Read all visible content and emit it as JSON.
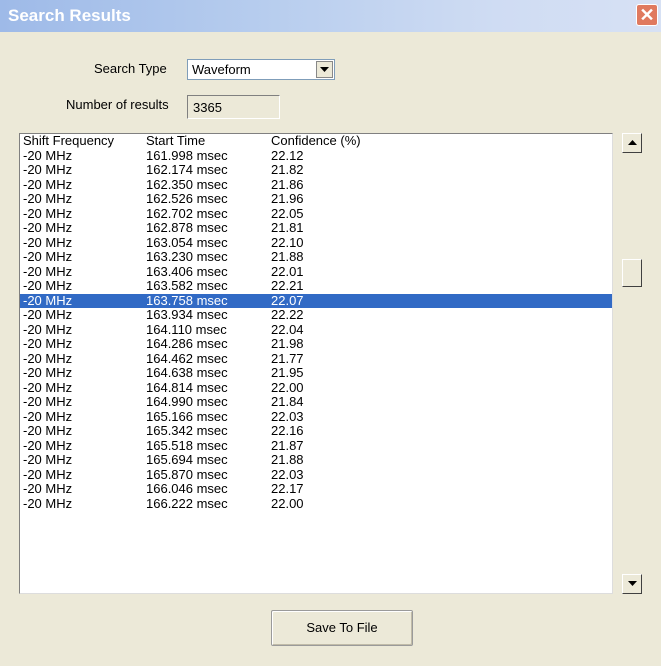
{
  "window": {
    "title": "Search Results",
    "close_glyph": "✕"
  },
  "search_type": {
    "label": "Search Type",
    "value": "Waveform"
  },
  "results_count": {
    "label": "Number of results",
    "value": "3365"
  },
  "table": {
    "headers": [
      "Shift Frequency",
      "Start Time",
      "Confidence (%)"
    ],
    "selected_index": 10,
    "rows": [
      [
        "-20 MHz",
        "161.998 msec",
        "22.12"
      ],
      [
        "-20 MHz",
        "162.174 msec",
        "21.82"
      ],
      [
        "-20 MHz",
        "162.350 msec",
        "21.86"
      ],
      [
        "-20 MHz",
        "162.526 msec",
        "21.96"
      ],
      [
        "-20 MHz",
        "162.702 msec",
        "22.05"
      ],
      [
        "-20 MHz",
        "162.878 msec",
        "21.81"
      ],
      [
        "-20 MHz",
        "163.054 msec",
        "22.10"
      ],
      [
        "-20 MHz",
        "163.230 msec",
        "21.88"
      ],
      [
        "-20 MHz",
        "163.406 msec",
        "22.01"
      ],
      [
        "-20 MHz",
        "163.582 msec",
        "22.21"
      ],
      [
        "-20 MHz",
        "163.758 msec",
        "22.07"
      ],
      [
        "-20 MHz",
        "163.934 msec",
        "22.22"
      ],
      [
        "-20 MHz",
        "164.110 msec",
        "22.04"
      ],
      [
        "-20 MHz",
        "164.286 msec",
        "21.98"
      ],
      [
        "-20 MHz",
        "164.462 msec",
        "21.77"
      ],
      [
        "-20 MHz",
        "164.638 msec",
        "21.95"
      ],
      [
        "-20 MHz",
        "164.814 msec",
        "22.00"
      ],
      [
        "-20 MHz",
        "164.990 msec",
        "21.84"
      ],
      [
        "-20 MHz",
        "165.166 msec",
        "22.03"
      ],
      [
        "-20 MHz",
        "165.342 msec",
        "22.16"
      ],
      [
        "-20 MHz",
        "165.518 msec",
        "21.87"
      ],
      [
        "-20 MHz",
        "165.694 msec",
        "21.88"
      ],
      [
        "-20 MHz",
        "165.870 msec",
        "22.03"
      ],
      [
        "-20 MHz",
        "166.046 msec",
        "22.17"
      ],
      [
        "-20 MHz",
        "166.222 msec",
        "22.00"
      ]
    ]
  },
  "actions": {
    "save_label": "Save To File"
  },
  "colors": {
    "selection": "#316ac5",
    "dialog_bg": "#ece9d8",
    "close_button": "#e07a5f"
  }
}
